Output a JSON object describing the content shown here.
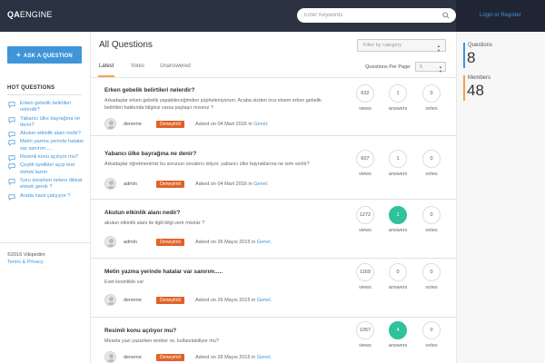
{
  "colors": {
    "topbar": "#2b3242",
    "accent": "#3f95d8",
    "badge": "#e0622a",
    "answered": "#2fc29b",
    "questions_bar": "#3f95d8",
    "members_bar": "#f0a44a"
  },
  "header": {
    "logo_bold": "QA",
    "logo_light": "ENGINE",
    "search_placeholder": "Enter Keywords",
    "login_label": "Login or Register"
  },
  "sidebar": {
    "ask_label": "ASK A QUESTION",
    "hot_title": "HOT QUESTIONS",
    "hot_questions": [
      "Erken gebelik belirtileri nelerdir?",
      "Yabancı ülke bayrağına ne denir?",
      "Akutun etkinlik alanı nedir?",
      "Metin yazma yerinde hatalar var sanırım.....",
      "Resimli konu açılıyor mu?",
      "Çeşitli üyelikler açıp test etmek lazım",
      "Soru sorarken nelere dikkat etmek gerek ?",
      "Arada nasıl çalışıyor ?"
    ],
    "copyright": "©2016 Vikipedim",
    "terms": "Terms & Privacy"
  },
  "main": {
    "title": "All Questions",
    "filter_placeholder": "Filter by category",
    "tabs": [
      "Latest",
      "Votes",
      "Unanswered"
    ],
    "per_page_label": "Questions Per Page:",
    "per_page_value": "5",
    "stat_labels": {
      "views": "views",
      "answers": "answers",
      "votes": "votes"
    },
    "questions": [
      {
        "title": "Erken gebelik belirtileri nelerdir?",
        "excerpt": "Arkadaşlar erken gebelik yapabileceğimden şüpheleniyorum. Acaba sizden rica etsem erken gebelik belirtileri hakkında bilginiz varsa paylaşır mısınız ?",
        "author": "deneme",
        "badge": "Deneyimli",
        "asked": "Asked on 04 Mart 2016 in",
        "category": "Genel.",
        "views": "632",
        "answers": "1",
        "votes": "0",
        "answered": false
      },
      {
        "title": "Yabancı ülke bayrağına ne denir?",
        "excerpt": "Arkadaşlar öğretmenimiz bu sorunun cevabını istiyor. yabancı ülke bayraklarına ne isim verilir?",
        "author": "admin",
        "badge": "Deneyimli",
        "asked": "Asked on 04 Mart 2016 in",
        "category": "Genel.",
        "views": "607",
        "answers": "1",
        "votes": "0",
        "answered": false
      },
      {
        "title": "Akutun etkinlik alanı nedir?",
        "excerpt": "akutun etkinlik alanı ile ilgili bilgi verir misiniz ?",
        "author": "admin",
        "badge": "Deneyimli",
        "asked": "Asked on 26 Mayıs 2015 in",
        "category": "Genel.",
        "views": "1272",
        "answers": "1",
        "votes": "0",
        "answered": true
      },
      {
        "title": "Metin yazma yerinde hatalar var sanırım.....",
        "excerpt": "Evet kesinlikle var",
        "author": "deneme",
        "badge": "Deneyimli",
        "asked": "Asked on 26 Mayıs 2015 in",
        "category": "Genel.",
        "views": "1169",
        "answers": "0",
        "votes": "0",
        "answered": false
      },
      {
        "title": "Resimli konu açılıyor mu?",
        "excerpt": "Mesela yazı yazarken renkler vs. kullanılabiliyor mu?",
        "author": "deneme",
        "badge": "Deneyimli",
        "asked": "Asked on 26 Mayıs 2015 in",
        "category": "Genel.",
        "views": "1357",
        "answers": "4",
        "votes": "0",
        "answered": true
      }
    ]
  },
  "stats": {
    "questions_label": "Questions",
    "questions_count": "8",
    "members_label": "Members",
    "members_count": "48"
  },
  "icons": {
    "search": "search-icon",
    "plus": "plus-icon",
    "hot_item": "chat-icon",
    "filter_caret": "caret-down-icon",
    "avatar": "user-avatar-icon"
  }
}
